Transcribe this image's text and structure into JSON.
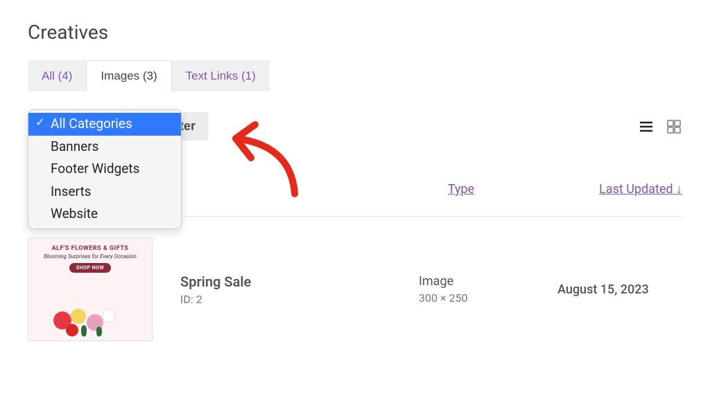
{
  "page_title": "Creatives",
  "tabs": [
    {
      "label": "All (4)"
    },
    {
      "label": "Images (3)"
    },
    {
      "label": "Text Links (1)"
    }
  ],
  "active_tab_index": 1,
  "filter_button": "Filter",
  "dropdown_items": [
    "All Categories",
    "Banners",
    "Footer Widgets",
    "Inserts",
    "Website"
  ],
  "dropdown_selected_index": 0,
  "columns": {
    "type": "Type",
    "last_updated": "Last Updated"
  },
  "row": {
    "name": "Spring Sale",
    "id_label": "ID: 2",
    "type": "Image",
    "dimensions": "300 × 250",
    "date": "August 15, 2023",
    "thumb": {
      "brand": "ALF'S FLOWERS & GIFTS",
      "tagline": "Blooming Surprises for Every Occasion",
      "cta": "SHOP NOW"
    }
  }
}
